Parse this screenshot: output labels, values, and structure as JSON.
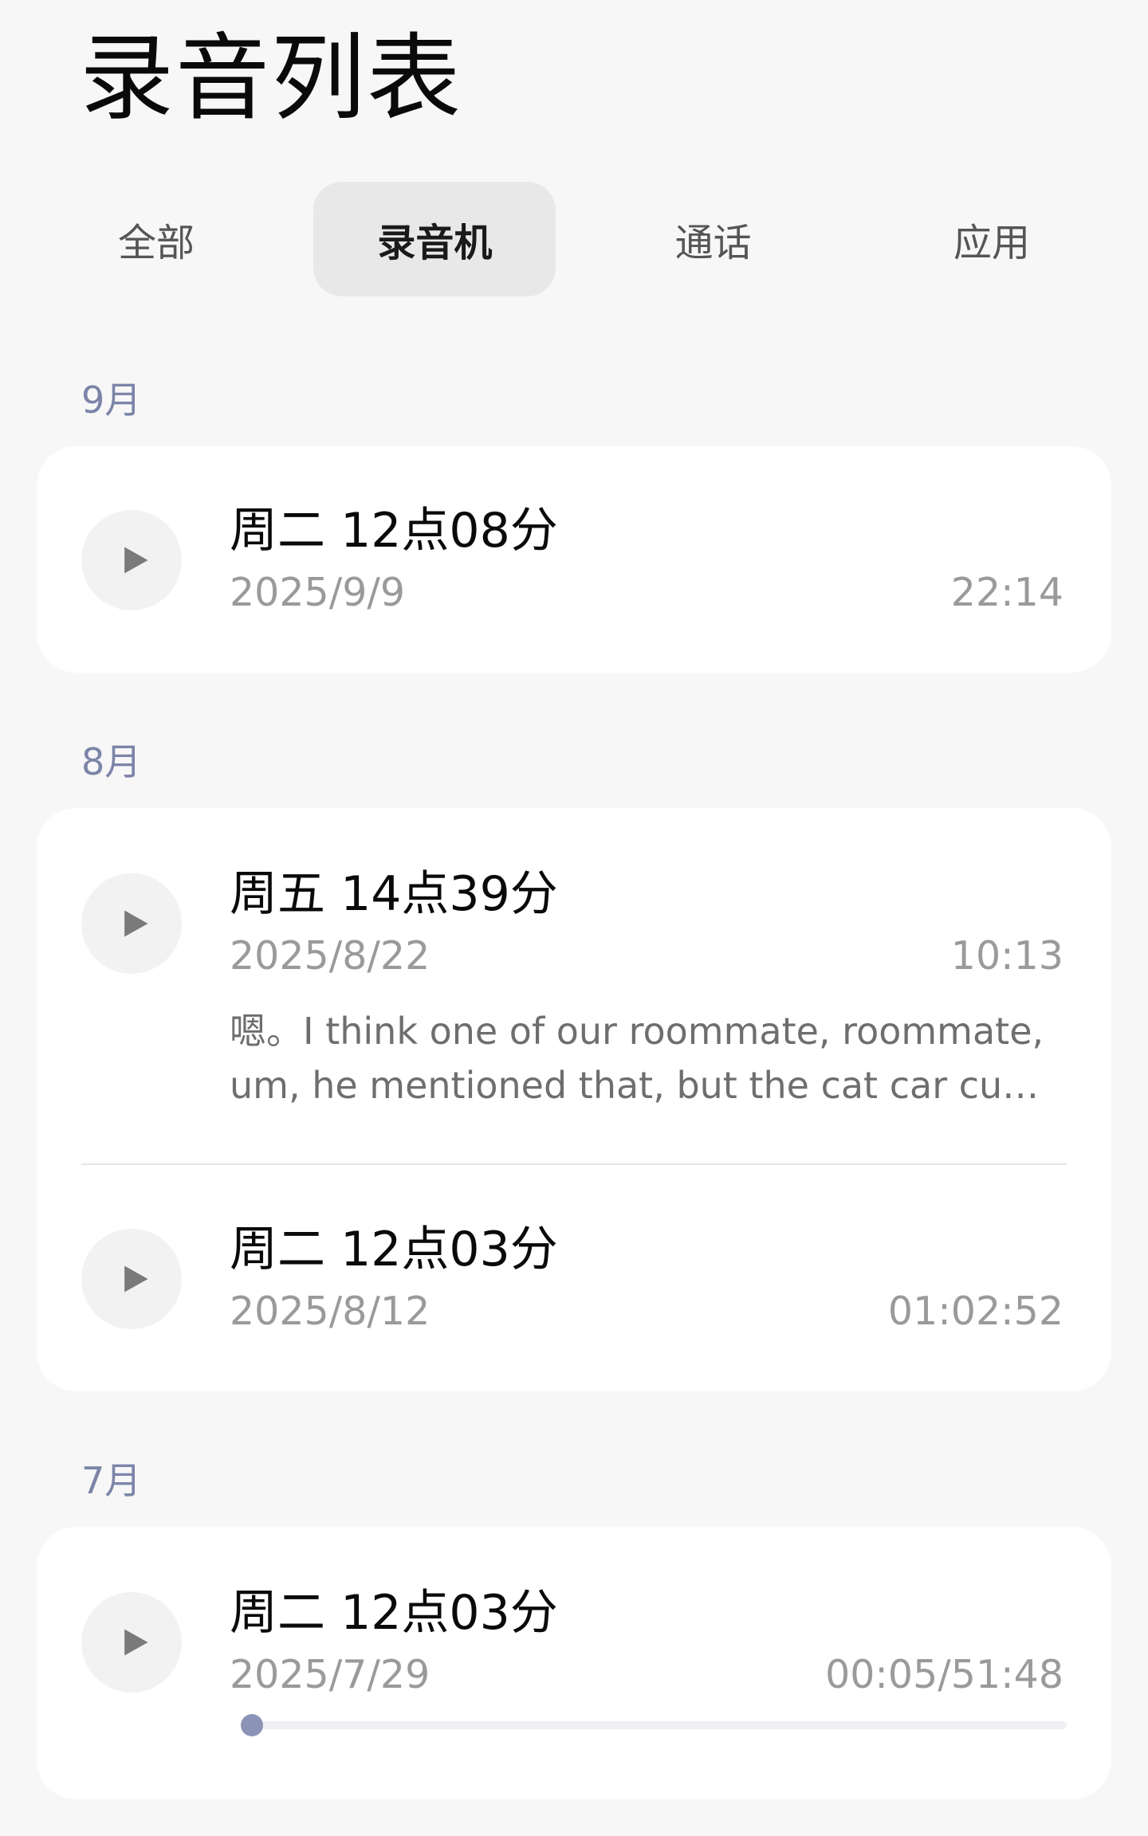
{
  "header": {
    "title": "录音列表"
  },
  "tabs": [
    {
      "label": "全部",
      "active": false
    },
    {
      "label": "录音机",
      "active": true
    },
    {
      "label": "通话",
      "active": false
    },
    {
      "label": "应用",
      "active": false
    }
  ],
  "groups": [
    {
      "month": "9月",
      "recordings": [
        {
          "title": "周二 12点08分",
          "date": "2025/9/9",
          "duration": "22:14"
        }
      ]
    },
    {
      "month": "8月",
      "recordings": [
        {
          "title": "周五 14点39分",
          "date": "2025/8/22",
          "duration": "10:13",
          "snippet": "嗯。I think one of our roommate, roommate, um, he mentioned that, but the cat car cu…"
        },
        {
          "title": "周二 12点03分",
          "date": "2025/8/12",
          "duration": "01:02:52"
        }
      ]
    },
    {
      "month": "7月",
      "recordings": [
        {
          "title": "周二 12点03分",
          "date": "2025/7/29",
          "duration": "00:05/51:48",
          "progress": 0.0
        }
      ]
    }
  ],
  "colors": {
    "accent": "#8b93b6",
    "month_label": "#7c85a8",
    "background": "#f7f7f7",
    "card": "#ffffff"
  },
  "icons": {
    "play": "play-icon"
  }
}
